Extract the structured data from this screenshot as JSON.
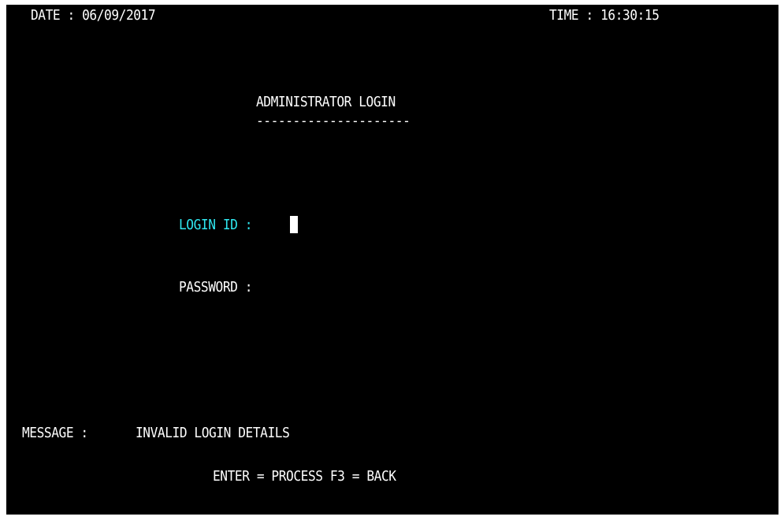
{
  "header": {
    "date_label": "DATE : 06/09/2017",
    "time_label": "TIME : 16:30:15"
  },
  "screen": {
    "title": "ADMINISTRATOR LOGIN",
    "title_underline": "---------------------"
  },
  "form": {
    "login_id_label": "LOGIN ID :",
    "login_id_value": "",
    "password_label": "PASSWORD :",
    "password_value": ""
  },
  "message": {
    "label": "MESSAGE :",
    "text": "INVALID LOGIN DETAILS"
  },
  "footer": {
    "keys_text": "ENTER = PROCESS F3 = BACK"
  },
  "colors": {
    "background": "#000000",
    "text": "#ffffff",
    "active_field_label": "#2fe7f0"
  }
}
